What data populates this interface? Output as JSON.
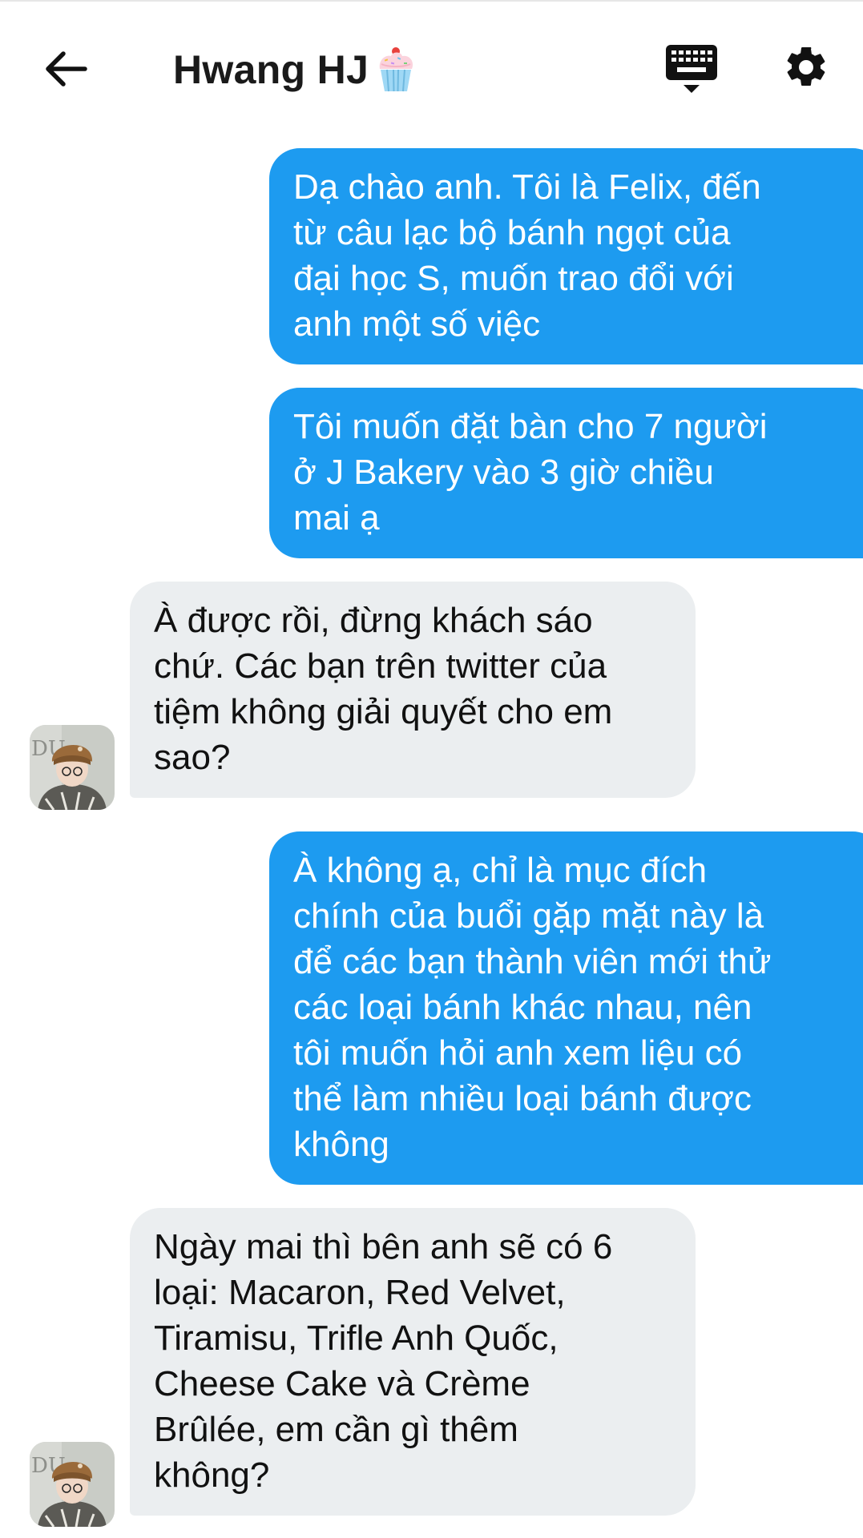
{
  "header": {
    "title": "Hwang HJ",
    "back_icon": "arrow-left-icon",
    "title_emoji": "cupcake-icon",
    "keyboard_icon": "keyboard-icon",
    "settings_icon": "gear-icon"
  },
  "colors": {
    "outgoing_bubble": "#1d9bf0",
    "incoming_bubble": "#ebeef0",
    "outgoing_text": "#ffffff",
    "incoming_text": "#111111"
  },
  "messages": [
    {
      "direction": "outgoing",
      "text": "Dạ chào anh. Tôi là Felix, đến\ntừ câu lạc bộ bánh ngọt của\nđại học S, muốn trao đổi với\nanh một số việc"
    },
    {
      "direction": "outgoing",
      "text": "Tôi muốn đặt bàn cho 7 người\nở J Bakery vào 3 giờ chiều\nmai ạ"
    },
    {
      "direction": "incoming",
      "text": "À được rồi, đừng khách sáo\nchứ. Các bạn trên twitter của\ntiệm không giải quyết cho em\nsao?"
    },
    {
      "direction": "outgoing",
      "text": "À không ạ, chỉ là mục đích\nchính của buổi gặp mặt này là\nđể các bạn thành viên mới thử\ncác loại bánh khác nhau, nên\ntôi muốn hỏi anh xem liệu có\nthể làm nhiều loại bánh được\nkhông"
    },
    {
      "direction": "incoming",
      "text": "Ngày mai thì bên anh sẽ có 6\nloại: Macaron, Red Velvet,\nTiramisu, Trifle Anh Quốc,\nCheese Cake và Crème\nBrûlée, em cần gì thêm\nkhông?"
    }
  ]
}
